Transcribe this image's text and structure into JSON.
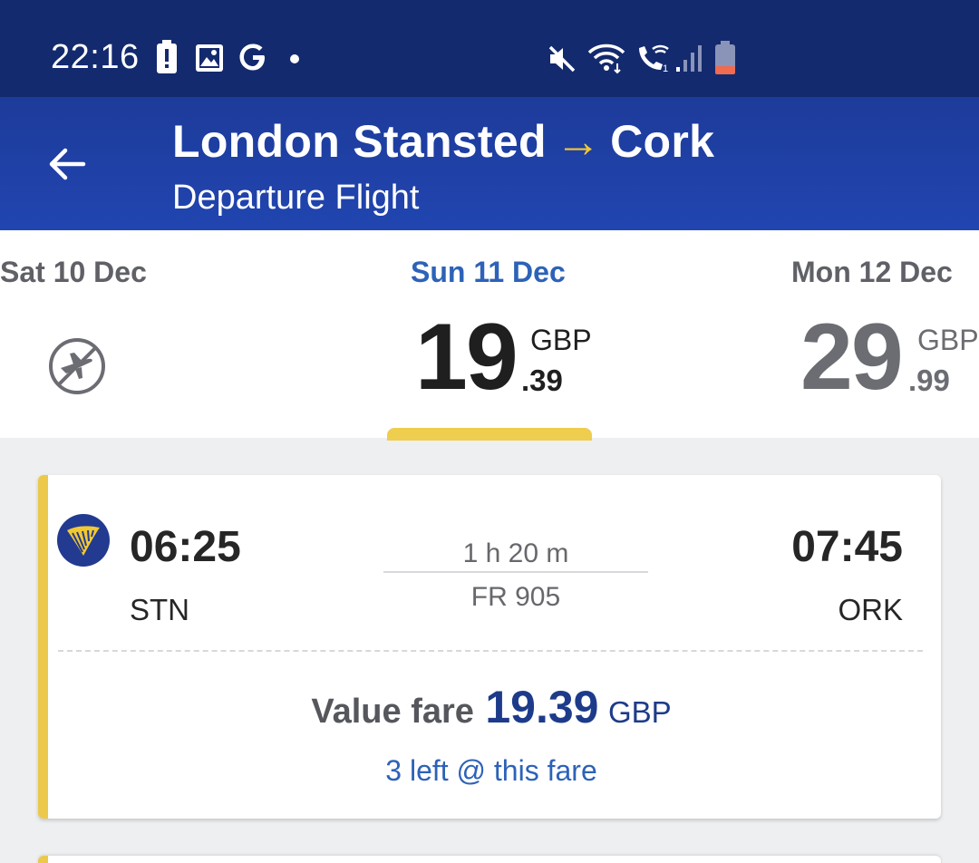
{
  "status_bar": {
    "time": "22:16",
    "left_icons": [
      "battery-alert-icon",
      "image-icon",
      "google-icon",
      "dot-icon"
    ],
    "right_icons": [
      "mute-icon",
      "wifi-icon",
      "wifi-calling-icon",
      "signal-icon",
      "battery-low-icon"
    ]
  },
  "header": {
    "back_icon": "arrow-left-icon",
    "origin": "London Stansted",
    "arrow": "→",
    "destination": "Cork",
    "subtitle": "Departure Flight"
  },
  "dates": [
    {
      "label": "Sat 10 Dec",
      "status": "no-flights",
      "icon": "no-flight-icon"
    },
    {
      "label": "Sun 11 Dec",
      "price_major": "19",
      "price_minor": ".39",
      "currency": "GBP",
      "selected": true
    },
    {
      "label": "Mon 12 Dec",
      "price_major": "29",
      "price_minor": ".99",
      "currency": "GBP"
    }
  ],
  "flight": {
    "airline_logo": "ryanair-harp-icon",
    "departure_time": "06:25",
    "departure_code": "STN",
    "duration": "1 h 20 m",
    "flight_number": "FR 905",
    "arrival_time": "07:45",
    "arrival_code": "ORK",
    "fare_label": "Value fare",
    "fare_amount": "19.39",
    "fare_currency": "GBP",
    "seats_left": "3 left @ this fare"
  },
  "colors": {
    "status_bar": "#142a6e",
    "header": "#2145b0",
    "accent_yellow": "#ecc94b",
    "active_blue": "#2d62b8",
    "fare_blue": "#1d3b8a"
  }
}
